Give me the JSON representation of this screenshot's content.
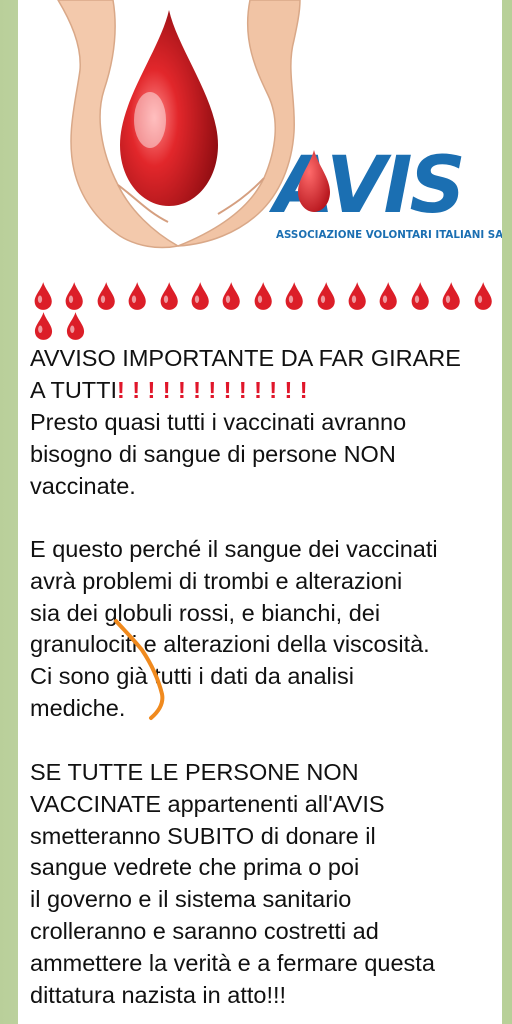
{
  "logo": {
    "brand": "AVIS",
    "tagline": "ASSOCIAZIONE VOLONTARI ITALIANI SANGUE",
    "brand_color": "#1b6fb2"
  },
  "drops": {
    "count": 17,
    "icon": "blood-drop-icon",
    "color": "#dc1e28"
  },
  "message": {
    "heading_line1": "AVVISO IMPORTANTE DA FAR GIRARE",
    "heading_line2": "A TUTTI",
    "exclamations": "!!!!!!!!!!!!!",
    "p1": "Presto quasi tutti i vaccinati avranno\nbisogno di sangue di persone NON\nvaccinate.",
    "p2": "E questo perché il sangue dei vaccinati\navrà problemi di trombi e alterazioni\nsia dei globuli rossi, e bianchi, dei\ngranulociti e alterazioni della viscosità.\nCi sono già tutti i dati da analisi\nmediche.",
    "p3": "SE TUTTE LE PERSONE NON\nVACCINATE appartenenti all'AVIS\nsmetteranno SUBITO di donare il\nsangue vedrete che prima o poi\nil governo e il sistema sanitario\ncrolleranno e saranno costretti ad\nammettere la verità e a fermare questa\ndittatura nazista in atto!!!"
  },
  "colors": {
    "annotation_stroke": "#f08a1e",
    "chat_background": "#cfe0b2",
    "bubble": "#ffffff"
  }
}
